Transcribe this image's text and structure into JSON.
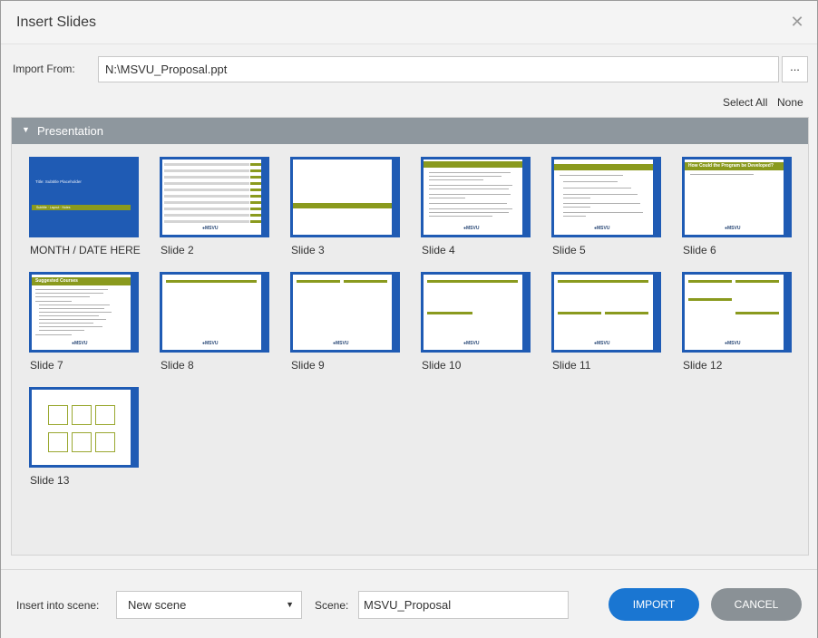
{
  "dialog": {
    "title": "Insert Slides",
    "close_icon": "close-icon"
  },
  "import_from": {
    "label": "Import From:",
    "path": "N:\\MSVU_Proposal.ppt",
    "browse_label": "..."
  },
  "selection": {
    "select_all": "Select All",
    "none": "None"
  },
  "panel": {
    "title": "Presentation",
    "expand_icon": "triangle-down-icon"
  },
  "slides": [
    {
      "label": "MONTH / DATE HERE",
      "thumb_text": "Title: Subtitle Placeholder",
      "thumb_footer": "Subtitle · Layout · Notes"
    },
    {
      "label": "Slide 2"
    },
    {
      "label": "Slide 3"
    },
    {
      "label": "Slide 4"
    },
    {
      "label": "Slide 5"
    },
    {
      "label": "Slide 6",
      "thumb_title": "How Could the Program be Developed?"
    },
    {
      "label": "Slide 7",
      "thumb_title": "Suggested Courses"
    },
    {
      "label": "Slide 8"
    },
    {
      "label": "Slide 9"
    },
    {
      "label": "Slide 10"
    },
    {
      "label": "Slide 11"
    },
    {
      "label": "Slide 12"
    },
    {
      "label": "Slide 13"
    }
  ],
  "footer": {
    "insert_label": "Insert into scene:",
    "insert_value": "New scene",
    "scene_label": "Scene:",
    "scene_value": "MSVU_Proposal",
    "import_button": "IMPORT",
    "cancel_button": "CANCEL"
  },
  "colors": {
    "accent_blue": "#1a76d2",
    "slide_border": "#1f5bb4",
    "slide_green": "#8a9a1e",
    "panel_header": "#8e979e",
    "cancel_grey": "#8a9196"
  }
}
